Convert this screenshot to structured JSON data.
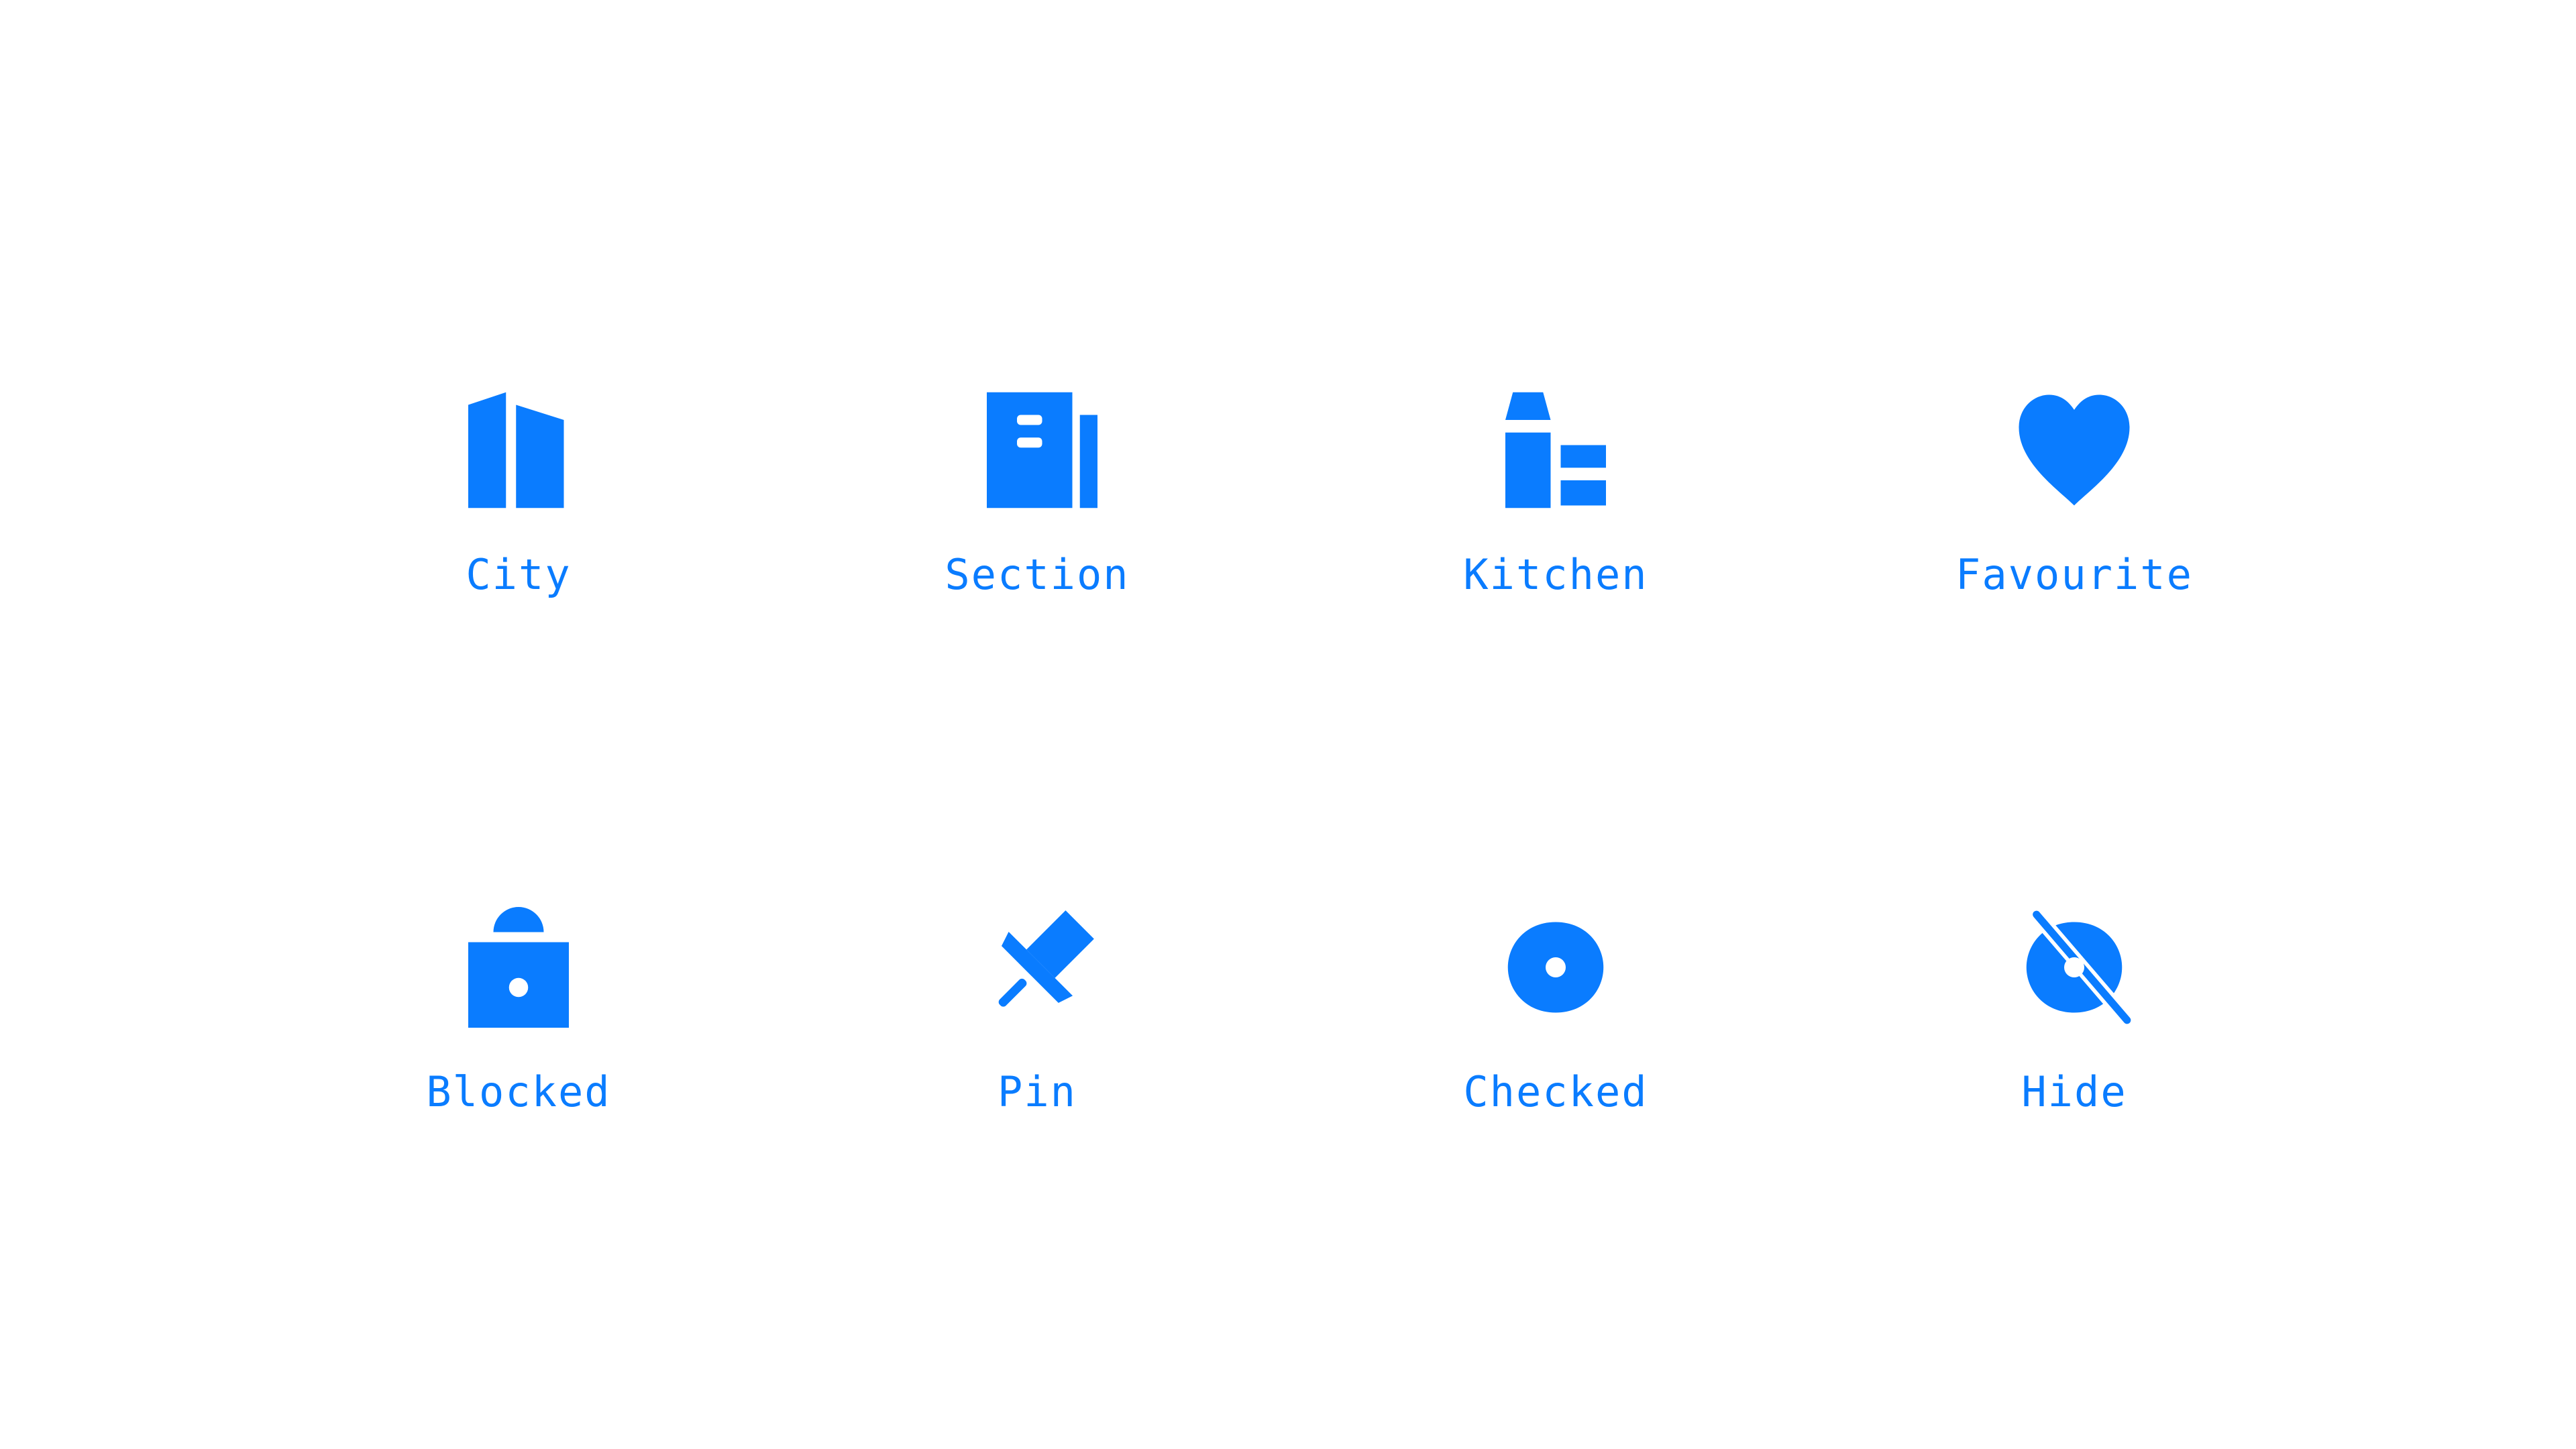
{
  "accent_color": "#0a7cff",
  "icons": [
    {
      "label": "City",
      "icon": "city-icon"
    },
    {
      "label": "Section",
      "icon": "section-icon"
    },
    {
      "label": "Kitchen",
      "icon": "kitchen-icon"
    },
    {
      "label": "Favourite",
      "icon": "heart-icon"
    },
    {
      "label": "Blocked",
      "icon": "lock-icon"
    },
    {
      "label": "Pin",
      "icon": "pin-icon"
    },
    {
      "label": "Checked",
      "icon": "eye-icon"
    },
    {
      "label": "Hide",
      "icon": "eye-off-icon"
    }
  ]
}
